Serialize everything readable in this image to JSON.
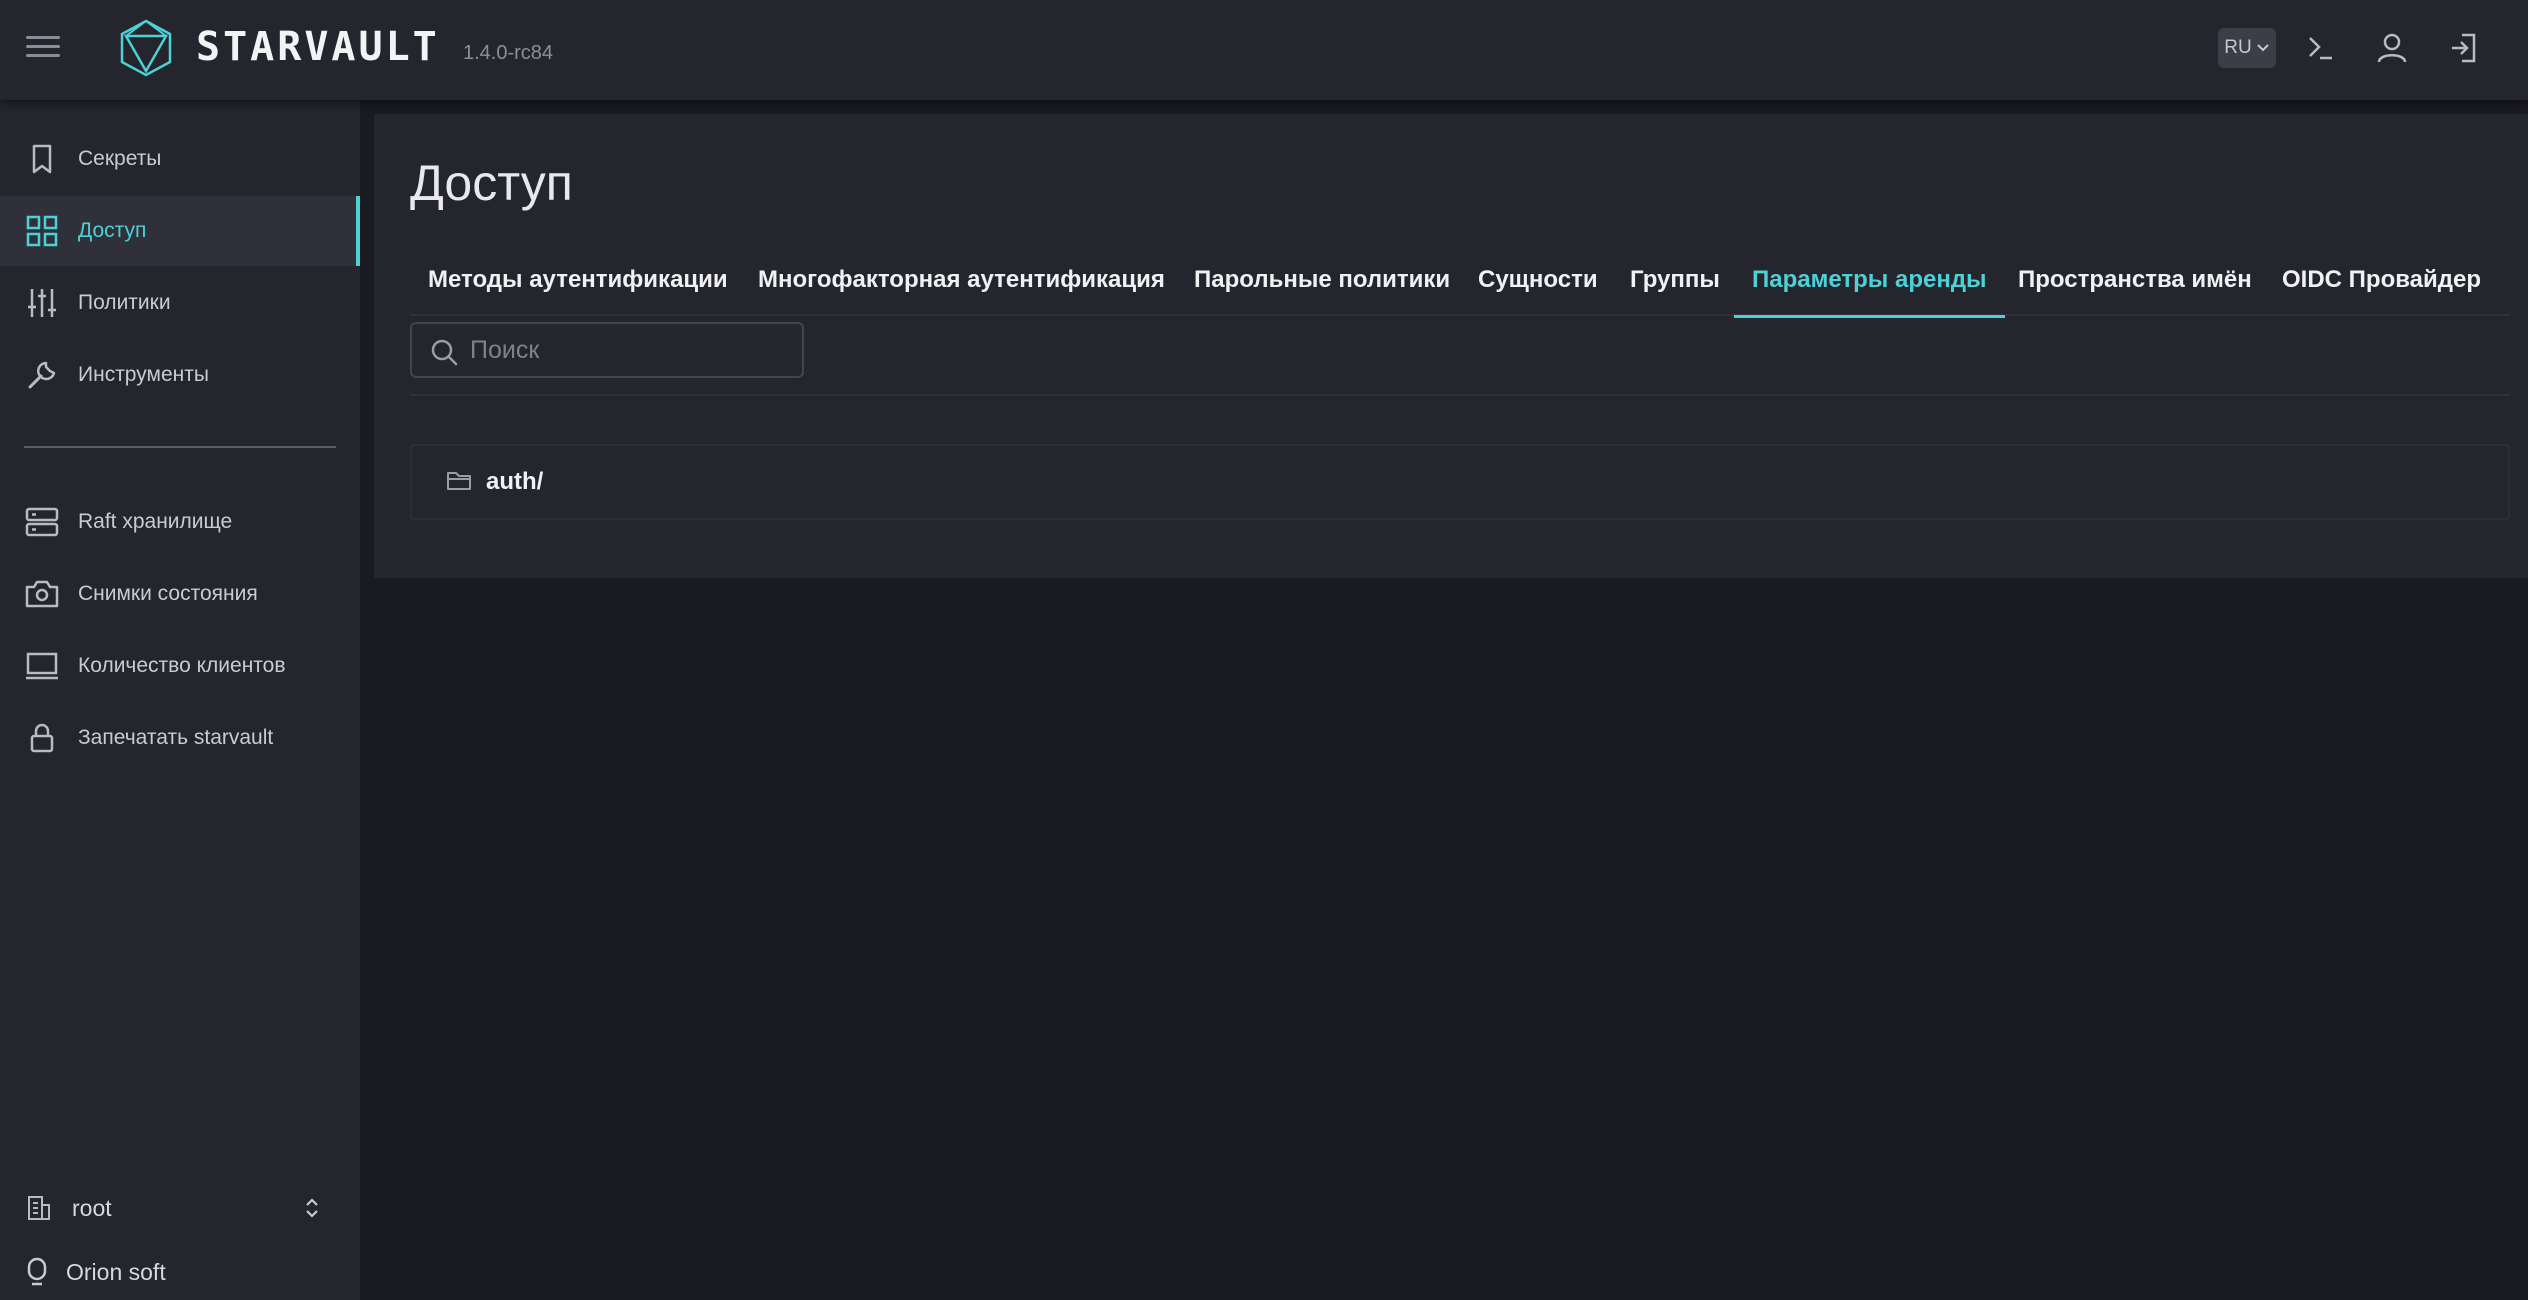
{
  "app": {
    "name": "STARVAULT",
    "version": "1.4.0-rc84"
  },
  "topbar": {
    "language": "RU"
  },
  "sidebar": {
    "items": [
      {
        "label": "Секреты"
      },
      {
        "label": "Доступ"
      },
      {
        "label": "Политики"
      },
      {
        "label": "Инструменты"
      },
      {
        "label": "Raft хранилище"
      },
      {
        "label": "Снимки состояния"
      },
      {
        "label": "Количество клиентов"
      },
      {
        "label": "Запечатать starvault"
      }
    ],
    "namespace": "root",
    "organization": "Orion soft"
  },
  "main": {
    "title": "Доступ",
    "tabs": [
      {
        "label": "Методы аутентификации"
      },
      {
        "label": "Многофакторная аутентификация"
      },
      {
        "label": "Парольные политики"
      },
      {
        "label": "Сущности"
      },
      {
        "label": "Группы"
      },
      {
        "label": "Параметры аренды"
      },
      {
        "label": "Пространства имён"
      },
      {
        "label": "OIDC Провайдер"
      }
    ],
    "search": {
      "placeholder": "Поиск",
      "value": ""
    },
    "list": [
      {
        "label": "auth/"
      }
    ]
  },
  "colors": {
    "accent": "#4dd0d6",
    "background": "#1a1b20",
    "surface": "#24252d"
  }
}
